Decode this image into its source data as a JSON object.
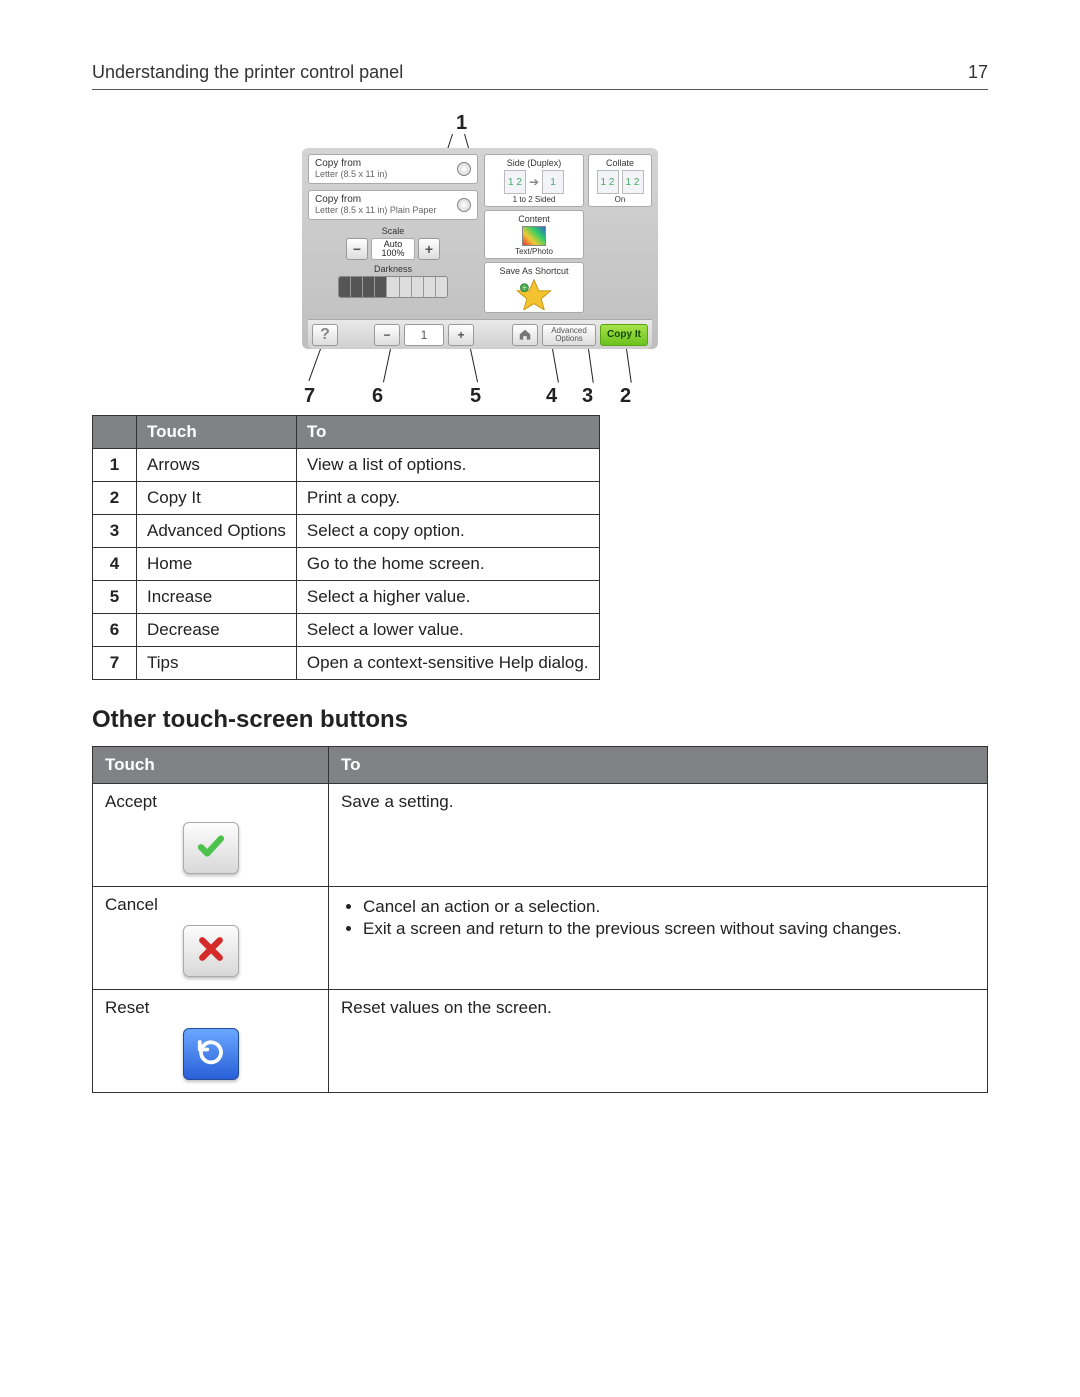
{
  "header": {
    "title": "Understanding the printer control panel",
    "page_number": "17"
  },
  "panel": {
    "copy_from_1": {
      "label": "Copy from",
      "sub": "Letter (8.5 x 11 in)"
    },
    "copy_from_2": {
      "label": "Copy from",
      "sub": "Letter (8.5 x 11 in) Plain Paper"
    },
    "scale": {
      "label": "Scale",
      "mode": "Auto",
      "value": "100%"
    },
    "darkness_label": "Darkness",
    "sides": {
      "title": "Side (Duplex)",
      "caption": "1 to 2 Sided"
    },
    "collate": {
      "title": "Collate",
      "caption": "On"
    },
    "content": {
      "title": "Content",
      "caption": "Text/Photo"
    },
    "shortcut_title": "Save As Shortcut",
    "bottom": {
      "count": "1",
      "advanced": "Advanced\nOptions",
      "copy_it": "Copy It"
    }
  },
  "callouts_top": {
    "n1": "1"
  },
  "callouts_bottom": {
    "n7": "7",
    "n6": "6",
    "n5": "5",
    "n4": "4",
    "n3": "3",
    "n2": "2"
  },
  "table1": {
    "headers": [
      "",
      "Touch",
      "To"
    ],
    "rows": [
      {
        "num": "1",
        "touch": "Arrows",
        "to": "View a list of options."
      },
      {
        "num": "2",
        "touch": "Copy It",
        "to": "Print a copy."
      },
      {
        "num": "3",
        "touch": "Advanced Options",
        "to": "Select a copy option."
      },
      {
        "num": "4",
        "touch": "Home",
        "to": "Go to the home screen."
      },
      {
        "num": "5",
        "touch": "Increase",
        "to": "Select a higher value."
      },
      {
        "num": "6",
        "touch": "Decrease",
        "to": "Select a lower value."
      },
      {
        "num": "7",
        "touch": "Tips",
        "to": "Open a context-sensitive Help dialog."
      }
    ]
  },
  "section_heading": "Other touch-screen buttons",
  "table2": {
    "headers": [
      "Touch",
      "To"
    ],
    "rows": [
      {
        "name": "Accept",
        "icon": "accept",
        "desc": [
          "Save a setting."
        ]
      },
      {
        "name": "Cancel",
        "icon": "cancel",
        "desc": [
          "Cancel an action or a selection.",
          "Exit a screen and return to the previous screen without saving changes."
        ]
      },
      {
        "name": "Reset",
        "icon": "reset",
        "desc": [
          "Reset values on the screen."
        ]
      }
    ]
  }
}
